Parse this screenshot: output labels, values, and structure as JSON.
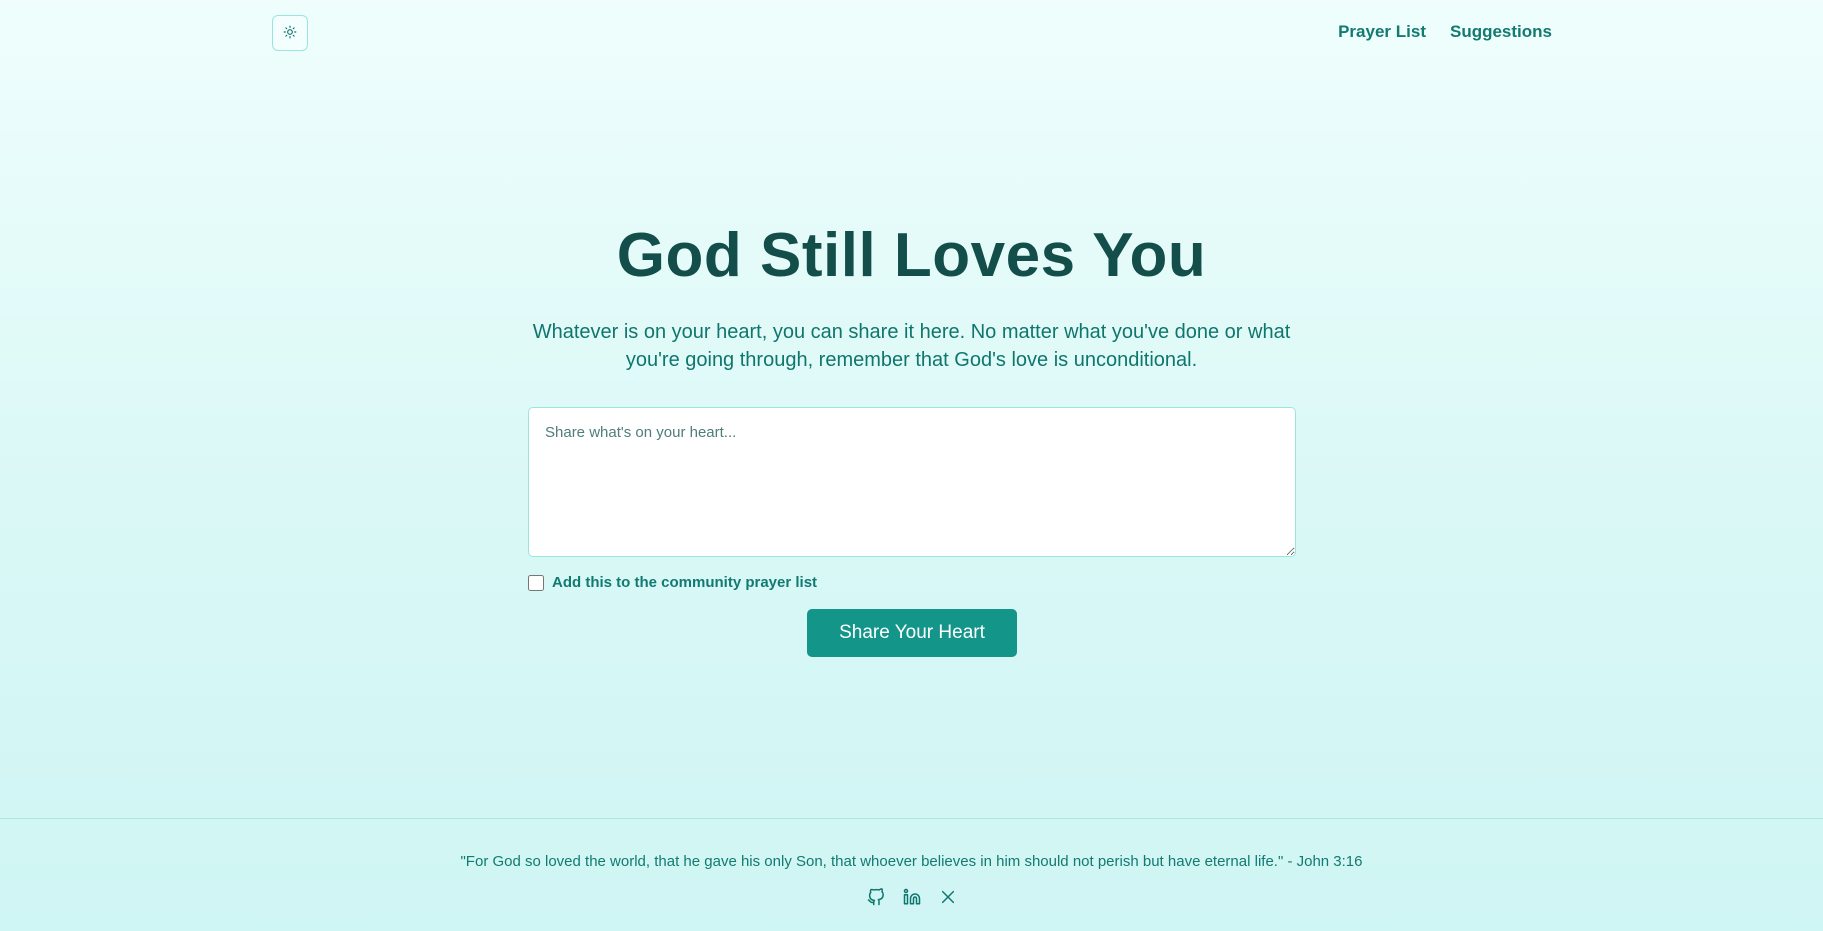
{
  "header": {
    "theme_toggle_icon": "sun-icon",
    "nav": [
      {
        "label": "Prayer List"
      },
      {
        "label": "Suggestions"
      }
    ]
  },
  "hero": {
    "title": "God Still Loves You",
    "subtitle": "Whatever is on your heart, you can share it here. No matter what you've done or what you're going through, remember that God's love is unconditional."
  },
  "form": {
    "textarea": {
      "placeholder": "Share what's on your heart...",
      "value": ""
    },
    "community_checkbox": {
      "label": "Add this to the community prayer list",
      "checked": false
    },
    "submit_label": "Share Your Heart"
  },
  "footer": {
    "verse": "\"For God so loved the world, that he gave his only Son, that whoever believes in him should not perish but have eternal life.\" - John 3:16",
    "social_icons": [
      "github-icon",
      "linkedin-icon",
      "x-icon"
    ]
  },
  "colors": {
    "accent": "#14958a",
    "heading": "#134e4a",
    "text": "#0f766e",
    "background_top": "#effefd",
    "background_bottom": "#cff5f4"
  }
}
